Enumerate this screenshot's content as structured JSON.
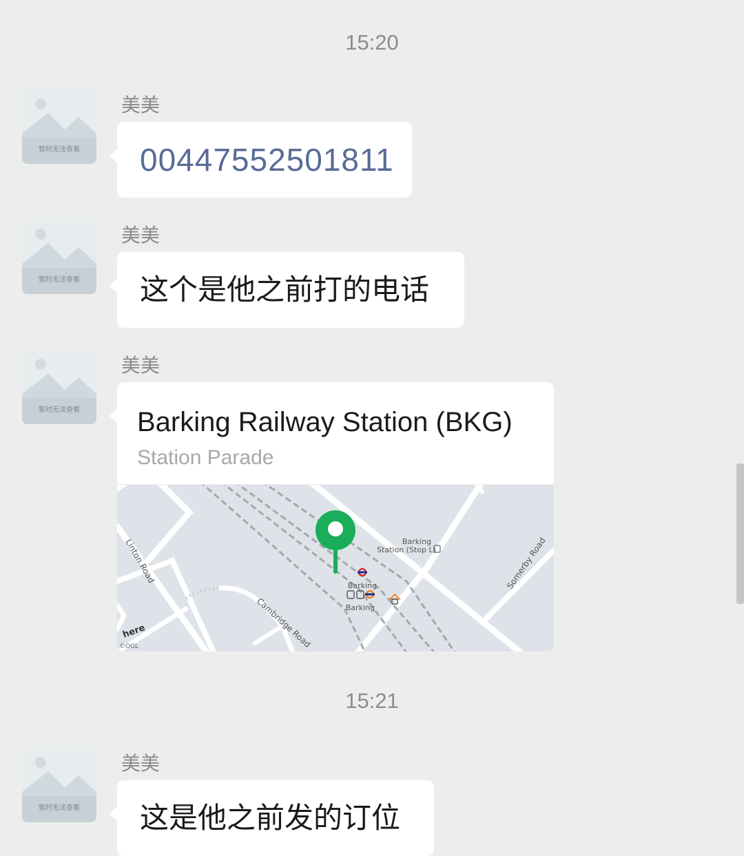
{
  "chat": {
    "timestamps": [
      "15:20",
      "15:21"
    ],
    "avatar_placeholder_text": "暂时无法查看",
    "messages": [
      {
        "sender": "美美",
        "type": "text",
        "text": "00447552501811"
      },
      {
        "sender": "美美",
        "type": "text",
        "text": "这个是他之前打的电话"
      },
      {
        "sender": "美美",
        "type": "location",
        "title": "Barking Railway Station (BKG)",
        "address": "Station Parade",
        "map": {
          "labels": {
            "linton_road": "Linton Road",
            "cambridge_road": "Cambridge Road",
            "somerby_road": "Somerby Road",
            "bus_stop_line1": "Barking",
            "bus_stop_line2": "Station (Stop L)",
            "station_line1": "Barking",
            "station_line2": "Barking",
            "attribution": "©OGL",
            "provider_logo": "here"
          },
          "pin_color": "#1aad5a"
        }
      },
      {
        "sender": "美美",
        "type": "text",
        "text": "这是他之前发的订位"
      }
    ]
  }
}
